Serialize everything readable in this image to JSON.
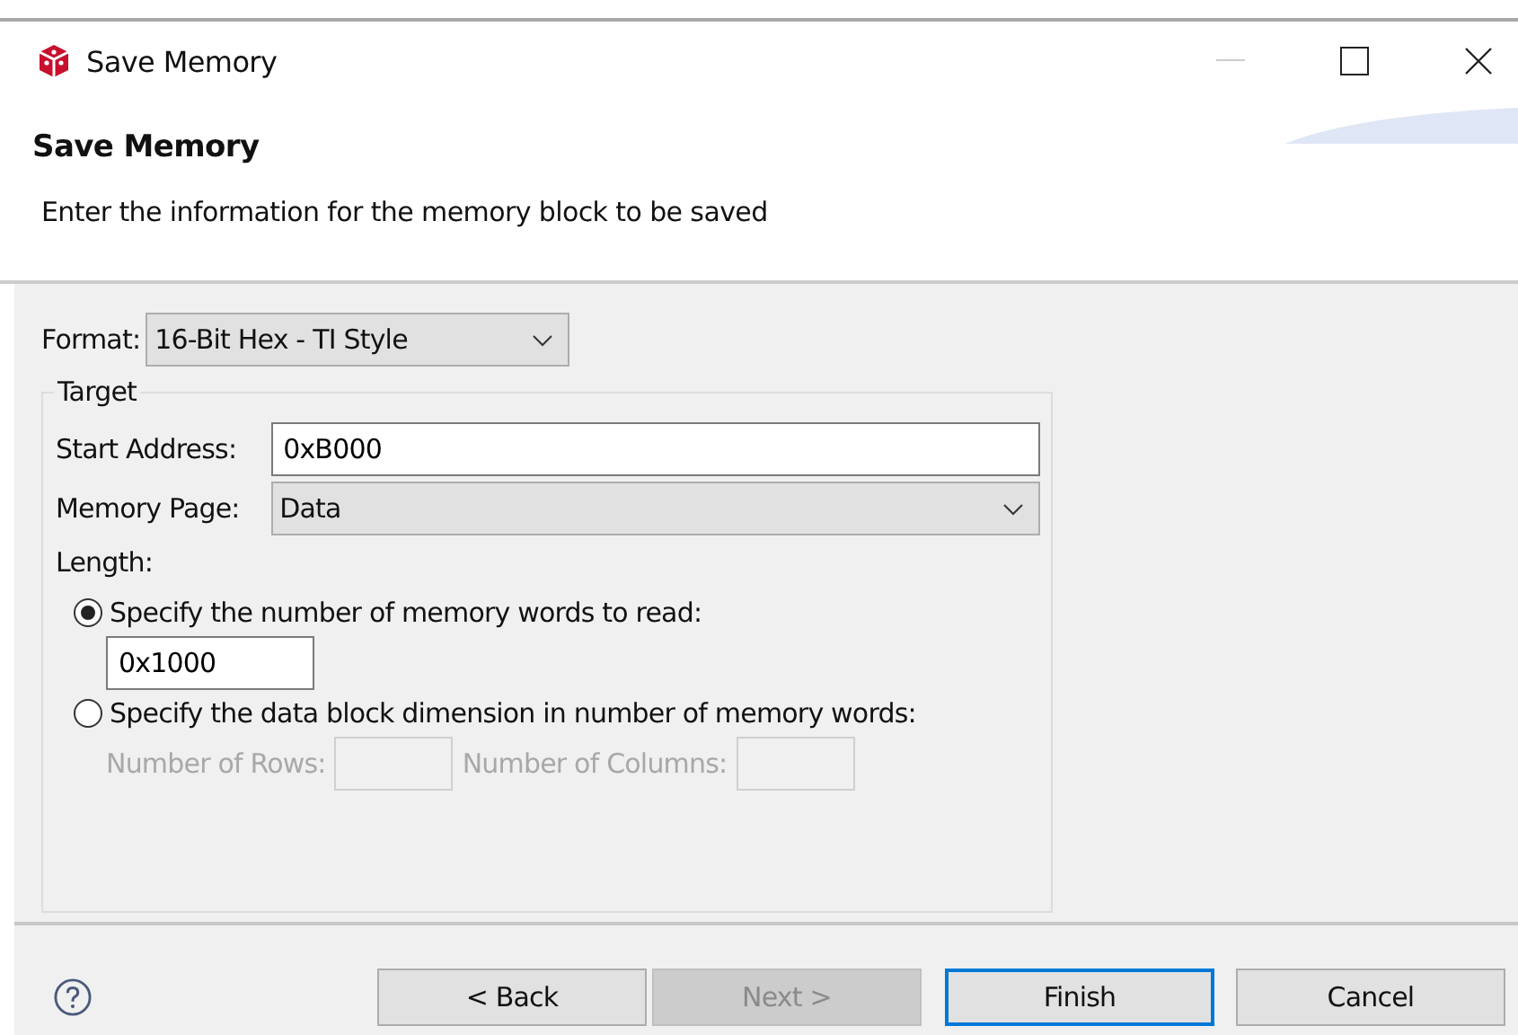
{
  "window": {
    "title": "Save Memory"
  },
  "header": {
    "title": "Save Memory",
    "description": "Enter the information for the memory block to be saved"
  },
  "format": {
    "label": "Format:",
    "value": "16-Bit Hex - TI Style"
  },
  "target": {
    "title": "Target",
    "start_address": {
      "label": "Start Address:",
      "value": "0xB000"
    },
    "memory_page": {
      "label": "Memory Page:",
      "value": "Data"
    },
    "length_label": "Length:",
    "options": [
      {
        "kind": "count",
        "label": "Specify the number of memory words to read:",
        "selected": true,
        "disabled": false,
        "value": "0x1000"
      },
      {
        "kind": "dimension",
        "label": "Specify the data block dimension in number of memory words:",
        "selected": false,
        "disabled": true,
        "rows_label": "Number of Rows:",
        "columns_label": "Number of Columns:"
      }
    ]
  },
  "buttons": [
    {
      "label": "< Back",
      "disabled": false,
      "default": false
    },
    {
      "label": "Next >",
      "disabled": true,
      "default": false
    },
    {
      "label": "Finish",
      "disabled": false,
      "default": true
    },
    {
      "label": "Cancel",
      "disabled": false,
      "default": false
    }
  ]
}
